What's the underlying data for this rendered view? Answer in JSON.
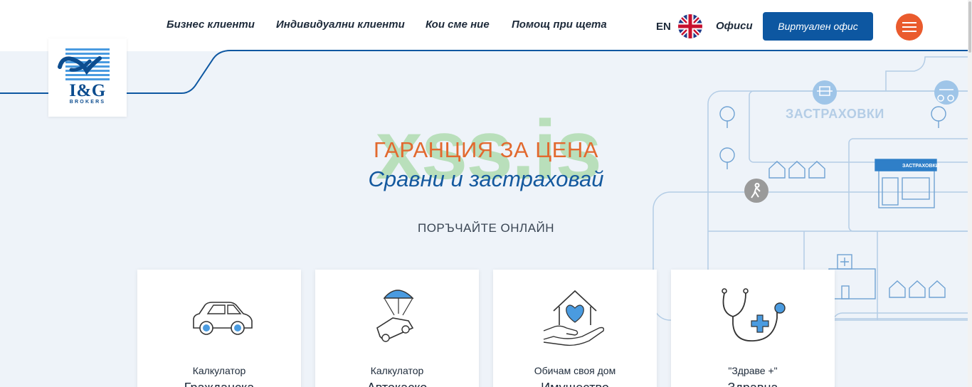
{
  "brand": {
    "logo_text": "I&G",
    "logo_sub": "BROKERS"
  },
  "nav": {
    "items": [
      {
        "label": "Бизнес клиенти"
      },
      {
        "label": "Индивидуални клиенти"
      },
      {
        "label": "Кои сме ние"
      },
      {
        "label": "Помощ при щета"
      }
    ],
    "lang": "EN",
    "offices": "Офиси",
    "virtual_office": "Виртуален офис"
  },
  "hero": {
    "watermark": "xss.is",
    "title": "ГАРАНЦИЯ ЗА ЦЕНА",
    "subtitle": "Сравни и застраховай",
    "order_online": "ПОРЪЧАЙТЕ ОНЛАЙН"
  },
  "map": {
    "label": "ЗАСТРАХОВКИ",
    "shop_sign": "ЗАСТРАХОВКИ"
  },
  "cards": [
    {
      "label": "Калкулатор",
      "label2": "Гражданска",
      "icon": "car-icon"
    },
    {
      "label": "Калкулатор",
      "label2": "Автокаско",
      "icon": "parachute-car-icon"
    },
    {
      "label": "Обичам своя дом",
      "label2": "Имущество",
      "icon": "home-heart-icon"
    },
    {
      "label": "\"Здраве +\"",
      "label2": "Здравна",
      "icon": "stethoscope-icon"
    }
  ],
  "colors": {
    "primary": "#0d57a1",
    "accent": "#ea5b2d",
    "title_orange": "#e2692f",
    "subtitle_blue": "#14599e",
    "map_line": "#b4cde6"
  }
}
